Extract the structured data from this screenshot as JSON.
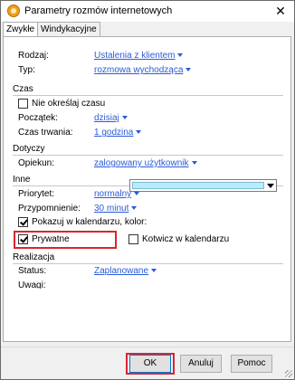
{
  "window": {
    "title": "Parametry rozmów internetowych",
    "close_glyph": "✕"
  },
  "tabs": [
    {
      "label": "Zwykłe"
    },
    {
      "label": "Windykacyjne"
    }
  ],
  "fields": {
    "rodzaj": {
      "label": "Rodzaj:",
      "value": "Ustalenia z klientem"
    },
    "typ": {
      "label": "Typ:",
      "value": "rozmowa wychodząca"
    },
    "czas_section": "Czas",
    "nie_okreslaj": {
      "label": "Nie określaj czasu",
      "checked": false
    },
    "poczatek": {
      "label": "Początek:",
      "value": "dzisiaj"
    },
    "czas_trwania": {
      "label": "Czas trwania:",
      "value": "1 godzina"
    },
    "dotyczy_section": "Dotyczy",
    "opiekun": {
      "label": "Opiekun:",
      "value": "zalogowany użytkownik"
    },
    "inne_section": "Inne",
    "priorytet": {
      "label": "Priorytet:",
      "value": "normalny"
    },
    "przypomnienie": {
      "label": "Przypomnienie:",
      "value": "30 minut"
    },
    "pokazuj": {
      "label": "Pokazuj w kalendarzu, kolor:",
      "checked": true,
      "color": "#b8ecff"
    },
    "prywatne": {
      "label": "Prywatne",
      "checked": true
    },
    "kotwicz": {
      "label": "Kotwicz w kalendarzu",
      "checked": false
    },
    "realizacja_section": "Realizacja",
    "status": {
      "label": "Status:",
      "value": "Zaplanowane"
    },
    "uwagi": {
      "label": "Uwagi:",
      "value": ""
    }
  },
  "buttons": {
    "ok": "OK",
    "cancel": "Anuluj",
    "help": "Pomoc"
  },
  "colors": {
    "link": "#2a5bd7",
    "highlight": "#d9262e",
    "accent": "#0078d7"
  }
}
